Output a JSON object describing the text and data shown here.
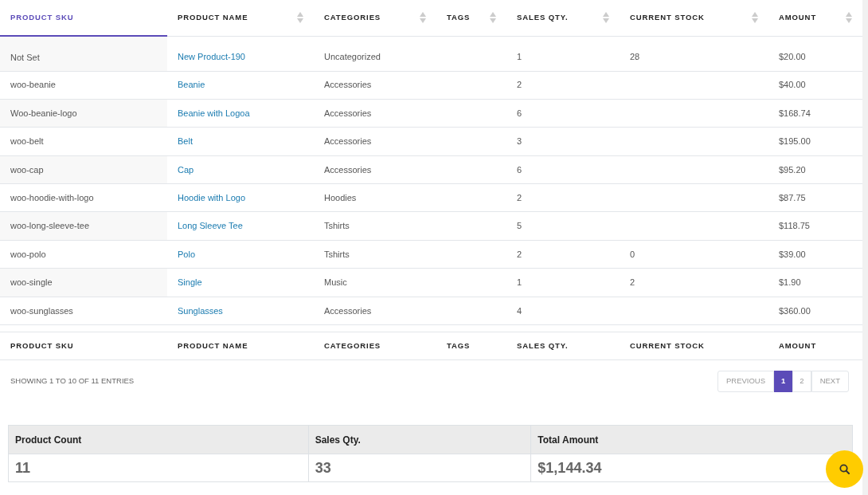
{
  "table": {
    "columns": [
      {
        "label": "PRODUCT SKU",
        "sorted": true
      },
      {
        "label": "PRODUCT NAME",
        "sorted": false
      },
      {
        "label": "CATEGORIES",
        "sorted": false
      },
      {
        "label": "TAGS",
        "sorted": false
      },
      {
        "label": "SALES QTY.",
        "sorted": false
      },
      {
        "label": "CURRENT STOCK",
        "sorted": false
      },
      {
        "label": "AMOUNT",
        "sorted": false
      }
    ],
    "rows": [
      {
        "sku": "Not Set",
        "name": "New Product-190",
        "category": "Uncategorized",
        "sales_qty": "1",
        "stock": "28",
        "amount": "$20.00"
      },
      {
        "sku": "woo-beanie",
        "name": "Beanie",
        "category": "Accessories",
        "sales_qty": "2",
        "amount": "$40.00"
      },
      {
        "sku": "Woo-beanie-logo",
        "name": "Beanie with Logoa",
        "category": "Accessories",
        "sales_qty": "6",
        "amount": "$168.74"
      },
      {
        "sku": "woo-belt",
        "name": "Belt",
        "category": "Accessories",
        "sales_qty": "3",
        "amount": "$195.00"
      },
      {
        "sku": "woo-cap",
        "name": "Cap",
        "category": "Accessories",
        "sales_qty": "6",
        "amount": "$95.20"
      },
      {
        "sku": "woo-hoodie-with-logo",
        "name": "Hoodie with Logo",
        "category": "Hoodies",
        "sales_qty": "2",
        "amount": "$87.75"
      },
      {
        "sku": "woo-long-sleeve-tee",
        "name": "Long Sleeve Tee",
        "category": "Tshirts",
        "sales_qty": "5",
        "amount": "$118.75"
      },
      {
        "sku": "woo-polo",
        "name": "Polo",
        "category": "Tshirts",
        "sales_qty": "2",
        "stock": "0",
        "amount": "$39.00"
      },
      {
        "sku": "woo-single",
        "name": "Single",
        "category": "Music",
        "sales_qty": "1",
        "stock": "2",
        "amount": "$1.90"
      },
      {
        "sku": "woo-sunglasses",
        "name": "Sunglasses",
        "category": "Accessories",
        "sales_qty": "4",
        "amount": "$360.00"
      }
    ],
    "footer": [
      "PRODUCT SKU",
      "PRODUCT NAME",
      "CATEGORIES",
      "TAGS",
      "SALES QTY.",
      "CURRENT STOCK",
      "AMOUNT"
    ]
  },
  "info": "SHOWING 1 TO 10 OF 11 ENTRIES",
  "pagination": [
    {
      "label": "PREVIOUS",
      "kind": "nav",
      "selected": false
    },
    {
      "label": "1",
      "kind": "page",
      "selected": true
    },
    {
      "label": "2",
      "kind": "page",
      "selected": false
    },
    {
      "label": "NEXT",
      "kind": "nav",
      "selected": false
    }
  ],
  "summary": [
    {
      "label": "Product Count",
      "value": "11"
    },
    {
      "label": "Sales Qty.",
      "value": "33"
    },
    {
      "label": "Total Amount",
      "value": "$1,144.34"
    }
  ]
}
